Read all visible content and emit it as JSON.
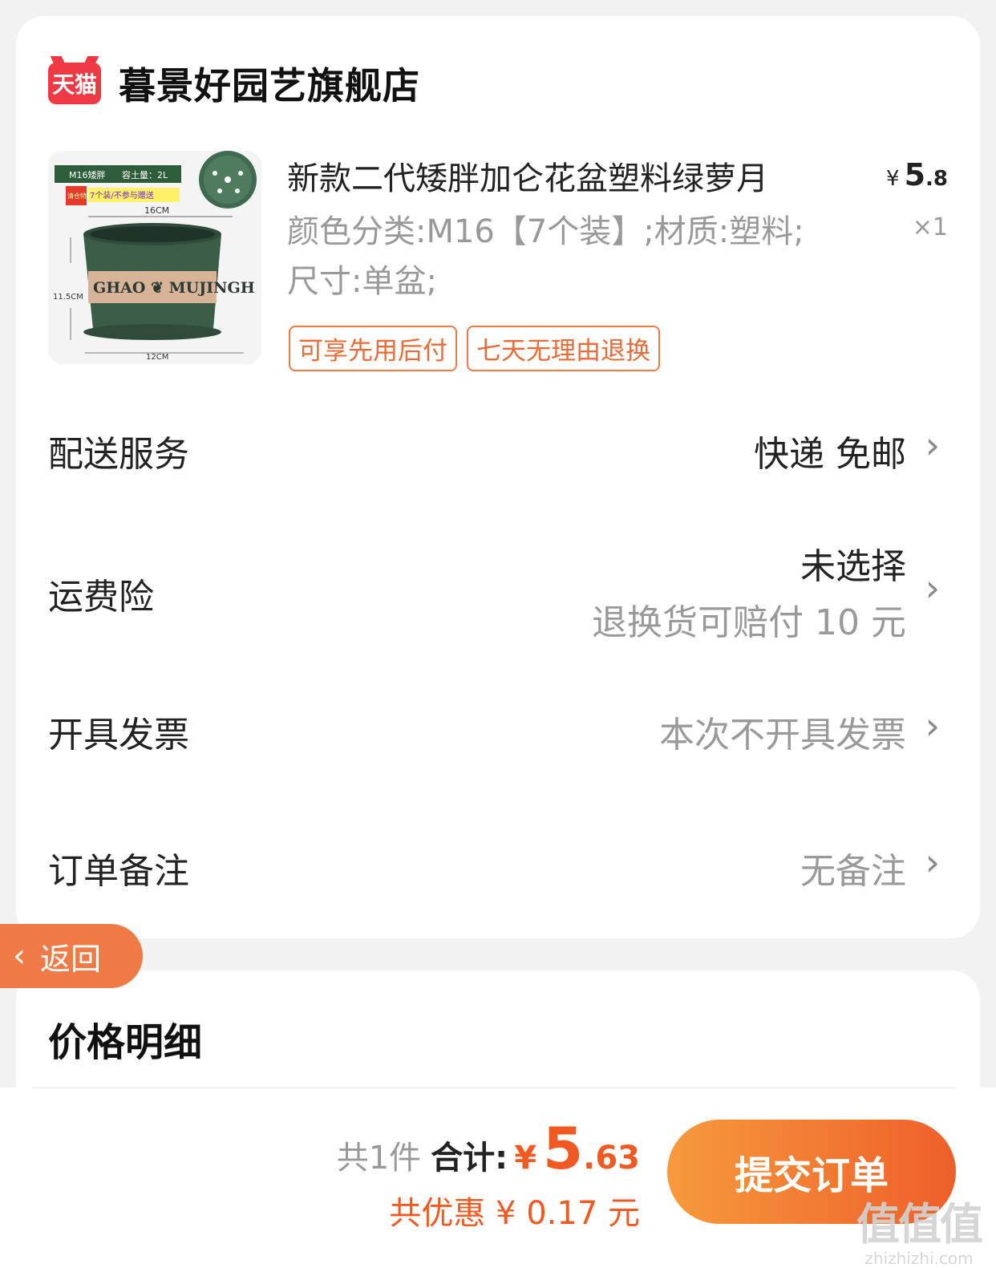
{
  "shop": {
    "logo_text": "天猫",
    "name": "暮景好园艺旗舰店"
  },
  "product": {
    "image": {
      "top_label_left": "M16矮胖",
      "top_label_right": "容土量：2L",
      "badge": "清仓特价",
      "banner": "7个装/不参与赠送",
      "width_top": "16CM",
      "height": "11.5CM",
      "width_bottom": "12CM",
      "pot_text": "GHAO ❦ MUJINGH"
    },
    "title": "新款二代矮胖加仑花盆塑料绿萝月",
    "price_symbol": "¥",
    "price_int": "5",
    "price_dec": ".8",
    "spec": "颜色分类:M16【7个装】;材质:塑料;尺寸:单盆;",
    "quantity": "×1",
    "tags": [
      "可享先用后付",
      "七天无理由退换"
    ]
  },
  "rows": {
    "delivery": {
      "label": "配送服务",
      "value": "快递 免邮"
    },
    "insurance": {
      "label": "运费险",
      "value": "未选择",
      "sub": "退换货可赔付 10 元"
    },
    "invoice": {
      "label": "开具发票",
      "value": "本次不开具发票"
    },
    "remark": {
      "label": "订单备注",
      "value": "无备注"
    }
  },
  "back": {
    "label": "返回"
  },
  "price_section": {
    "title": "价格明细"
  },
  "footer": {
    "count": "共1件",
    "sum_label": "合计:",
    "yen": "¥",
    "total_int": "5",
    "total_dec": ".63",
    "discount": "共优惠 ¥ 0.17 元",
    "submit": "提交订单"
  },
  "watermark": {
    "glyphs": "值值值",
    "url": "zhizhizhi.com"
  },
  "colors": {
    "accent": "#f05a22",
    "tag_border": "#f07a45",
    "tmall_red": "#ef3a45",
    "pot_green": "#3b5d47"
  }
}
